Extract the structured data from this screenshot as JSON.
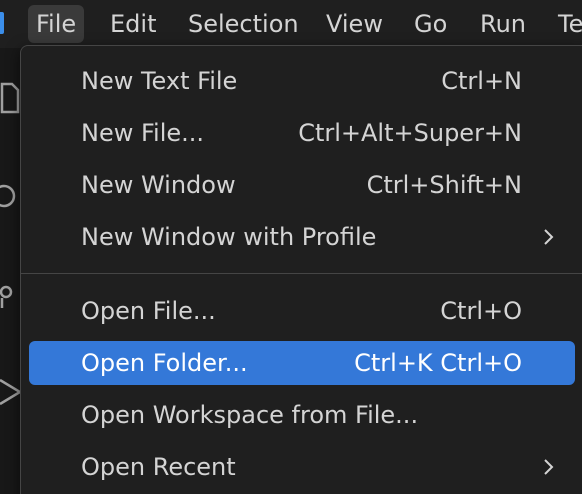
{
  "menubar": {
    "items": [
      "File",
      "Edit",
      "Selection",
      "View",
      "Go",
      "Run",
      "Te"
    ]
  },
  "file_menu": {
    "items": [
      {
        "label": "New Text File",
        "shortcut": "Ctrl+N"
      },
      {
        "label": "New File...",
        "shortcut": "Ctrl+Alt+Super+N"
      },
      {
        "label": "New Window",
        "shortcut": "Ctrl+Shift+N"
      },
      {
        "label": "New Window with Profile",
        "shortcut": "",
        "submenu_icon": "chevron-right-icon"
      },
      {
        "label": "Open File...",
        "shortcut": "Ctrl+O"
      },
      {
        "label": "Open Folder...",
        "shortcut": "Ctrl+K Ctrl+O",
        "selected": true
      },
      {
        "label": "Open Workspace from File...",
        "shortcut": ""
      },
      {
        "label": "Open Recent",
        "shortcut": "",
        "submenu_icon": "chevron-right-icon"
      }
    ]
  },
  "colors": {
    "background": "#1f1f1f",
    "menu_border": "#454545",
    "selection": "#3478d8",
    "text": "#d4d4d4",
    "accent": "#3b8eea"
  }
}
